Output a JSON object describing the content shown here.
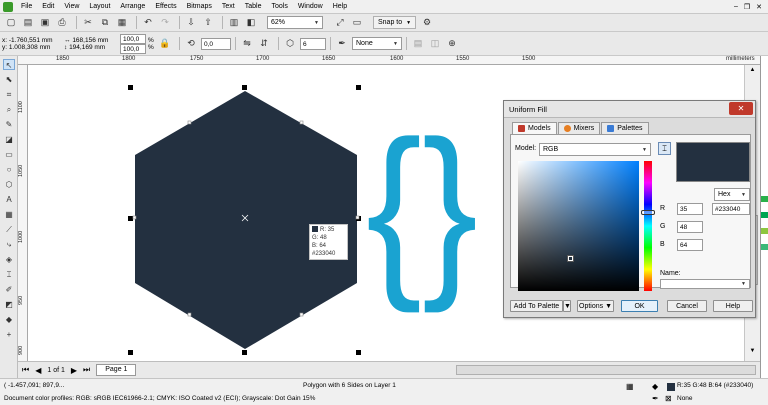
{
  "menu": [
    "File",
    "Edit",
    "View",
    "Layout",
    "Arrange",
    "Effects",
    "Bitmaps",
    "Text",
    "Table",
    "Tools",
    "Window",
    "Help"
  ],
  "toolbar1": {
    "zoom": "62%",
    "snap_to": "Snap to"
  },
  "toolbar2": {
    "x": "x: -1.760,551 mm",
    "y": "y: 1.008,308 mm",
    "w": "168,156 mm",
    "h": "194,169 mm",
    "scale_w": "100,0",
    "scale_h": "100,0",
    "pct": "%",
    "angle": "0,0",
    "sides": "6",
    "outline": "None"
  },
  "ruler": {
    "h_labels": [
      "1850",
      "1800",
      "1750",
      "1700",
      "1650",
      "1600",
      "1550",
      "1500"
    ],
    "unit": "millimeters",
    "v_labels": [
      "1100",
      "1050",
      "1000",
      "950",
      "900"
    ]
  },
  "page_nav": {
    "counter": "1 of 1",
    "tab": "Page 1"
  },
  "tooltip": {
    "r": "R: 35",
    "g": "G: 48",
    "b": "B: 64",
    "hex": "#233040"
  },
  "status": {
    "coords": "( -1.457,091; 897,9...",
    "object": "Polygon with 6 Sides on Layer 1",
    "profiles": "Document color profiles: RGB: sRGB IEC61966-2.1; CMYK: ISO Coated v2 (ECI); Grayscale: Dot Gain 15%",
    "fill": "R:35 G:48 B:64 (#233040)",
    "outline": "None"
  },
  "dialog": {
    "title": "Uniform Fill",
    "tabs": [
      "Models",
      "Mixers",
      "Palettes"
    ],
    "model_label": "Model:",
    "model_value": "RGB",
    "format": "Hex",
    "r_label": "R",
    "r_value": "35",
    "g_label": "G",
    "g_value": "48",
    "b_label": "B",
    "b_value": "64",
    "hex_value": "#233040",
    "name_label": "Name:",
    "btn_add": "Add To Palette",
    "btn_options": "Options",
    "btn_ok": "OK",
    "btn_cancel": "Cancel",
    "btn_help": "Help"
  },
  "colors": {
    "fill": "#233040",
    "brace": "#1aa3d1",
    "accent_hue": "#00a0ff"
  }
}
